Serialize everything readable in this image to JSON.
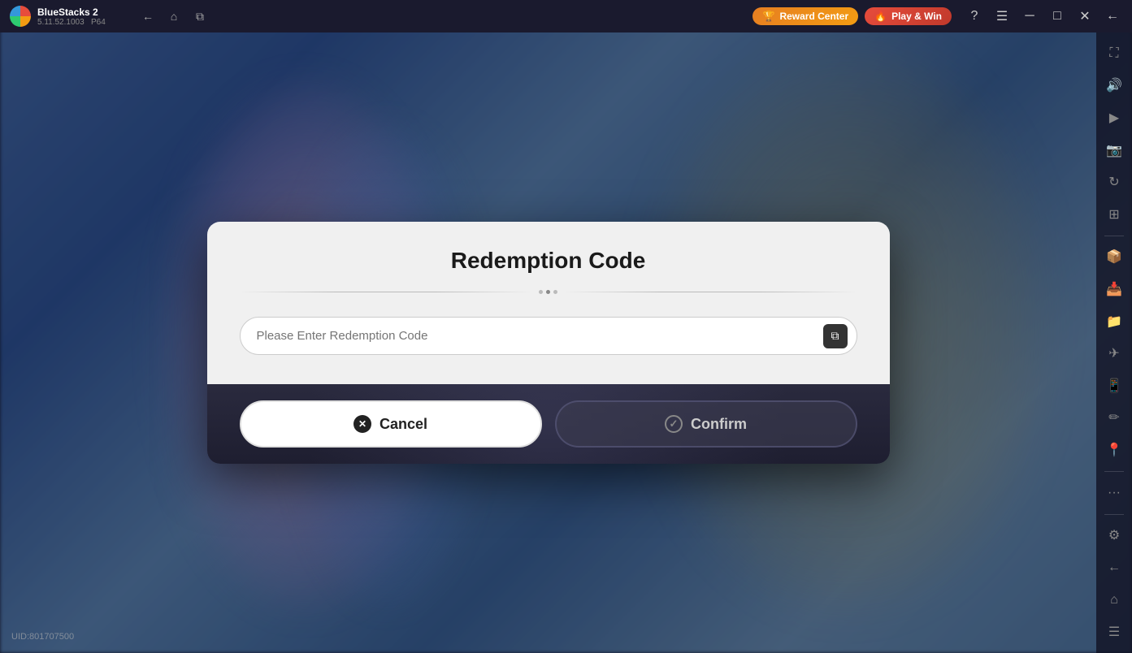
{
  "app": {
    "name": "BlueStacks 2",
    "version": "5.11.52.1003",
    "arch": "P64"
  },
  "topbar": {
    "back_label": "←",
    "home_label": "⌂",
    "tabs_label": "⧉",
    "reward_center_label": "Reward Center",
    "play_win_label": "Play & Win",
    "help_icon": "?",
    "menu_icon": "☰",
    "minimize_icon": "─",
    "restore_icon": "□",
    "close_icon": "✕",
    "back_nav_icon": "←"
  },
  "sidebar": {
    "icons": [
      {
        "name": "fullscreen-icon",
        "glyph": "⛶"
      },
      {
        "name": "volume-icon",
        "glyph": "🔊"
      },
      {
        "name": "screen-record-icon",
        "glyph": "▶"
      },
      {
        "name": "screenshot-icon",
        "glyph": "📷"
      },
      {
        "name": "rotate-icon",
        "glyph": "↻"
      },
      {
        "name": "layers-icon",
        "glyph": "⊞"
      },
      {
        "name": "install-icon",
        "glyph": "📦"
      },
      {
        "name": "camera-icon",
        "glyph": "📷"
      },
      {
        "name": "folder-icon",
        "glyph": "📁"
      },
      {
        "name": "plane-icon",
        "glyph": "✈"
      },
      {
        "name": "phone-icon",
        "glyph": "📱"
      },
      {
        "name": "draw-icon",
        "glyph": "✏"
      },
      {
        "name": "pin-icon",
        "glyph": "📍"
      },
      {
        "name": "more-icon",
        "glyph": "···"
      },
      {
        "name": "settings-icon",
        "glyph": "⚙"
      },
      {
        "name": "arrow-left-icon",
        "glyph": "←"
      },
      {
        "name": "home-sidebar-icon",
        "glyph": "⌂"
      },
      {
        "name": "menu-sidebar-icon",
        "glyph": "☰"
      }
    ]
  },
  "uid": {
    "label": "UID:801707500"
  },
  "dialog": {
    "title": "Redemption Code",
    "input_placeholder": "Please Enter Redemption Code",
    "cancel_label": "Cancel",
    "confirm_label": "Confirm",
    "paste_icon": "📋"
  }
}
